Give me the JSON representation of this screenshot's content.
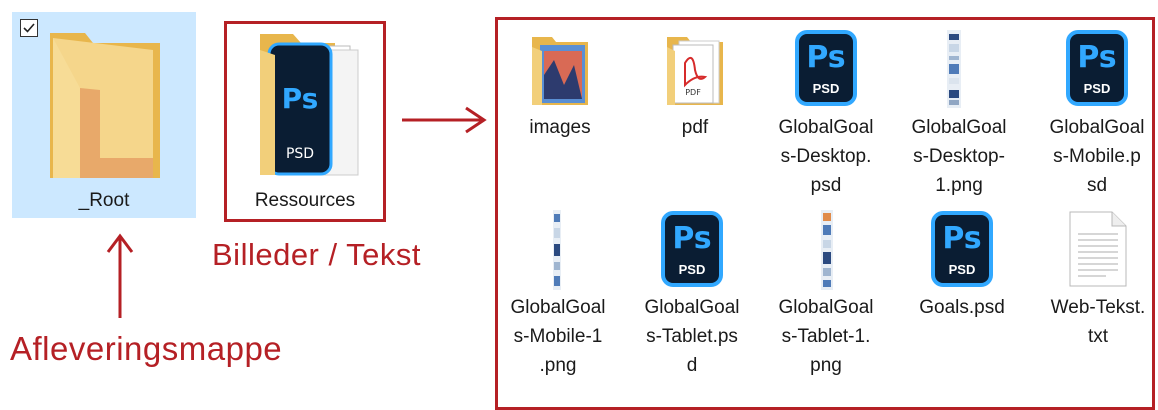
{
  "folders": {
    "root": {
      "label": "_Root",
      "selected": true,
      "icon": "folder-icon"
    },
    "ressources": {
      "label": "Ressources",
      "icon": "photoshop-folder-icon"
    }
  },
  "annotations": {
    "billeder": "Billeder / Tekst",
    "aflevering": "Afleveringsmappe",
    "color": "#b52025"
  },
  "files": [
    {
      "label": "images",
      "icon": "image-folder-icon"
    },
    {
      "label": "pdf",
      "icon": "pdf-folder-icon"
    },
    {
      "label": "GlobalGoal\ns-Desktop.\npsd",
      "icon": "photoshop-file-icon"
    },
    {
      "label": "GlobalGoal\ns-Desktop-\n1.png",
      "icon": "png-thumbnail-icon"
    },
    {
      "label": "GlobalGoal\ns-Mobile.p\nsd",
      "icon": "photoshop-file-icon"
    },
    {
      "label": "GlobalGoal\ns-Mobile-1\n.png",
      "icon": "png-thumbnail-icon"
    },
    {
      "label": "GlobalGoal\ns-Tablet.ps\nd",
      "icon": "photoshop-file-icon"
    },
    {
      "label": "GlobalGoal\ns-Tablet-1.\npng",
      "icon": "png-thumbnail-icon"
    },
    {
      "label": "Goals.psd",
      "icon": "photoshop-file-icon"
    },
    {
      "label": "Web-Tekst.\ntxt",
      "icon": "text-file-icon"
    }
  ],
  "photoshop": {
    "title": "Ps",
    "ext": "PSD",
    "bg": "#0a1d33",
    "accent": "#31a8ff"
  }
}
